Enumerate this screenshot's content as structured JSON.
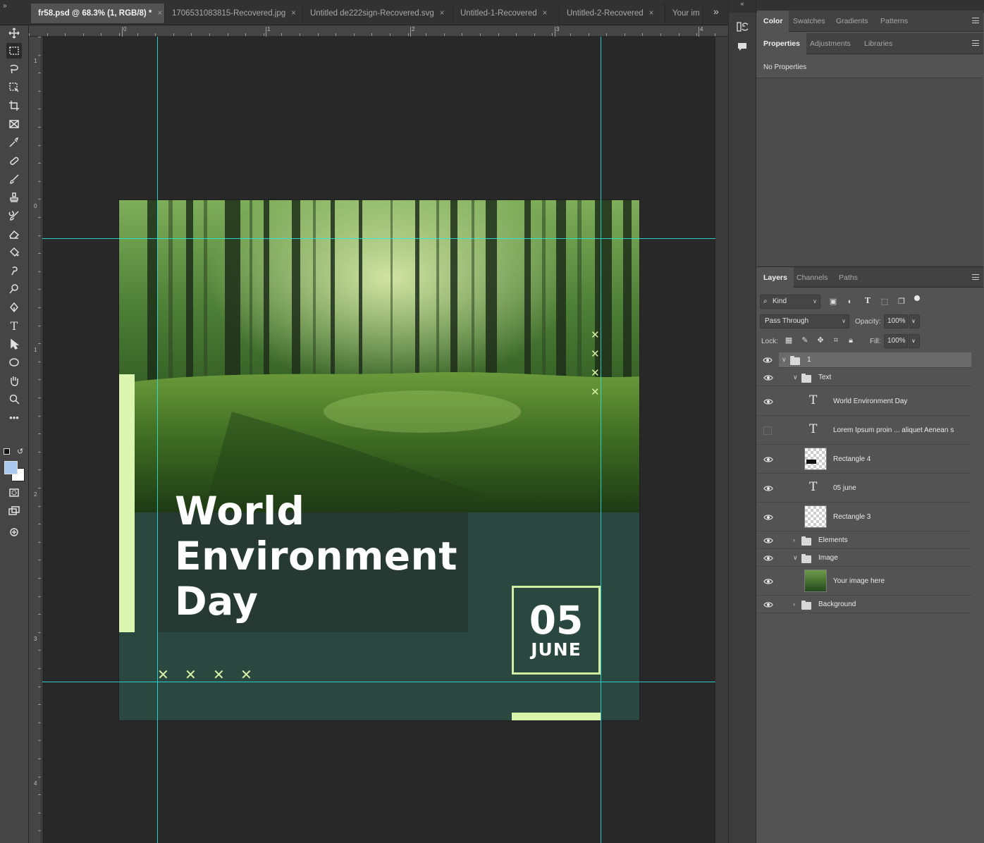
{
  "tabs": [
    {
      "label": "fr58.psd @ 68.3% (1, RGB/8) *",
      "active": true
    },
    {
      "label": "1706531083815-Recovered.jpg",
      "active": false
    },
    {
      "label": "Untitled de222sign-Recovered.svg",
      "active": false
    },
    {
      "label": "Untitled-1-Recovered",
      "active": false
    },
    {
      "label": "Untitled-2-Recovered",
      "active": false
    },
    {
      "label": "Your im",
      "active": false
    }
  ],
  "tab_close_glyph": "×",
  "tab_overflow_glyph": "»",
  "panel_collapse_glyph": "«",
  "toolbar_collapse_glyph": "»",
  "ruler": {
    "top_numbers": [
      "0",
      "1",
      "2",
      "3",
      "4"
    ],
    "left_numbers": [
      "1",
      "0",
      "1",
      "2",
      "3",
      "4"
    ]
  },
  "design": {
    "title": "World\nEnvironment\nDay",
    "date_day": "05",
    "date_month": "JUNE",
    "x_glyph": "✕",
    "colors": {
      "background": "#2b4840",
      "accent": "#dcf5b0",
      "title_box": "#263a33",
      "guide": "#2ee6e0"
    }
  },
  "color_panel": {
    "tabs": [
      "Color",
      "Swatches",
      "Gradients",
      "Patterns"
    ]
  },
  "properties_panel": {
    "tabs": [
      "Properties",
      "Adjustments",
      "Libraries"
    ],
    "empty_text": "No Properties"
  },
  "layers_panel": {
    "tabs": [
      "Layers",
      "Channels",
      "Paths"
    ],
    "filter_kind": "Kind",
    "blend_mode": "Pass Through",
    "opacity_label": "Opacity:",
    "opacity_value": "100%",
    "lock_label": "Lock:",
    "fill_label": "Fill:",
    "fill_value": "100%",
    "layers": [
      {
        "name": "1",
        "type": "group",
        "expanded": true,
        "visible": true,
        "selected": true
      },
      {
        "name": "Text",
        "type": "group",
        "expanded": true,
        "visible": true
      },
      {
        "name": "World Environment Day",
        "type": "text",
        "visible": true
      },
      {
        "name": "Lorem Ipsum proin ... aliquet Aenean s",
        "type": "text",
        "visible": false
      },
      {
        "name": "Rectangle 4",
        "type": "shape",
        "visible": true
      },
      {
        "name": "05 june",
        "type": "text",
        "visible": true
      },
      {
        "name": "Rectangle 3",
        "type": "shape",
        "visible": true
      },
      {
        "name": "Elements",
        "type": "group",
        "expanded": false,
        "visible": true
      },
      {
        "name": "Image",
        "type": "group",
        "expanded": true,
        "visible": true
      },
      {
        "name": "Your image here",
        "type": "smart-object",
        "visible": true
      },
      {
        "name": "Background",
        "type": "group",
        "expanded": false,
        "visible": true
      }
    ]
  },
  "icons": {
    "tools": [
      "move-icon",
      "rectangular-marquee-icon",
      "lasso-icon",
      "object-selection-icon",
      "crop-icon",
      "frame-icon",
      "eyedropper-icon",
      "spot-healing-icon",
      "brush-icon",
      "clone-stamp-icon",
      "history-brush-icon",
      "eraser-icon",
      "paint-bucket-icon",
      "smudge-icon",
      "dodge-icon",
      "pen-icon",
      "type-icon",
      "path-selection-icon",
      "ellipse-icon",
      "hand-icon",
      "zoom-icon",
      "more-tools-icon"
    ]
  }
}
